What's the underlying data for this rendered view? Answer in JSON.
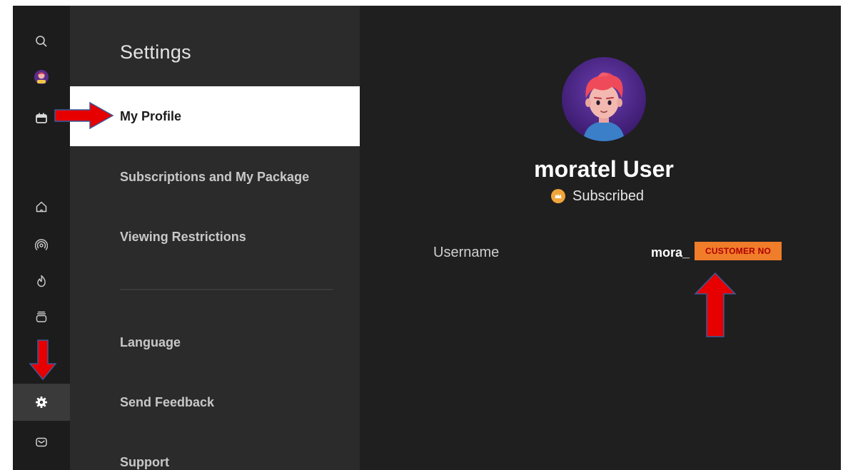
{
  "rail": {
    "icons": [
      {
        "name": "search-icon"
      },
      {
        "name": "avatar-icon"
      },
      {
        "name": "calendar-icon"
      },
      {
        "name": "home-icon"
      },
      {
        "name": "live-icon"
      },
      {
        "name": "trending-icon"
      },
      {
        "name": "library-icon"
      },
      {
        "name": "gear-icon",
        "active": true
      },
      {
        "name": "mail-icon"
      }
    ]
  },
  "menu": {
    "title": "Settings",
    "items": [
      {
        "label": "My Profile",
        "selected": true
      },
      {
        "label": "Subscriptions and My Package"
      },
      {
        "label": "Viewing Restrictions"
      },
      {
        "label": "Language"
      },
      {
        "label": "Send Feedback"
      },
      {
        "label": "Support"
      }
    ]
  },
  "profile": {
    "name": "moratel User",
    "status": "Subscribed",
    "fields": [
      {
        "label": "Username",
        "value": "mora_"
      }
    ],
    "redaction_label": "CUSTOMER NO"
  },
  "colors": {
    "selected_bg": "#ffffff",
    "panel_bg": "#2b2b2b",
    "content_bg": "#1f1f1f",
    "status_accent": "#f0a53a",
    "redaction_bg": "#f07d2a",
    "annotation_arrow": "#e00000"
  }
}
